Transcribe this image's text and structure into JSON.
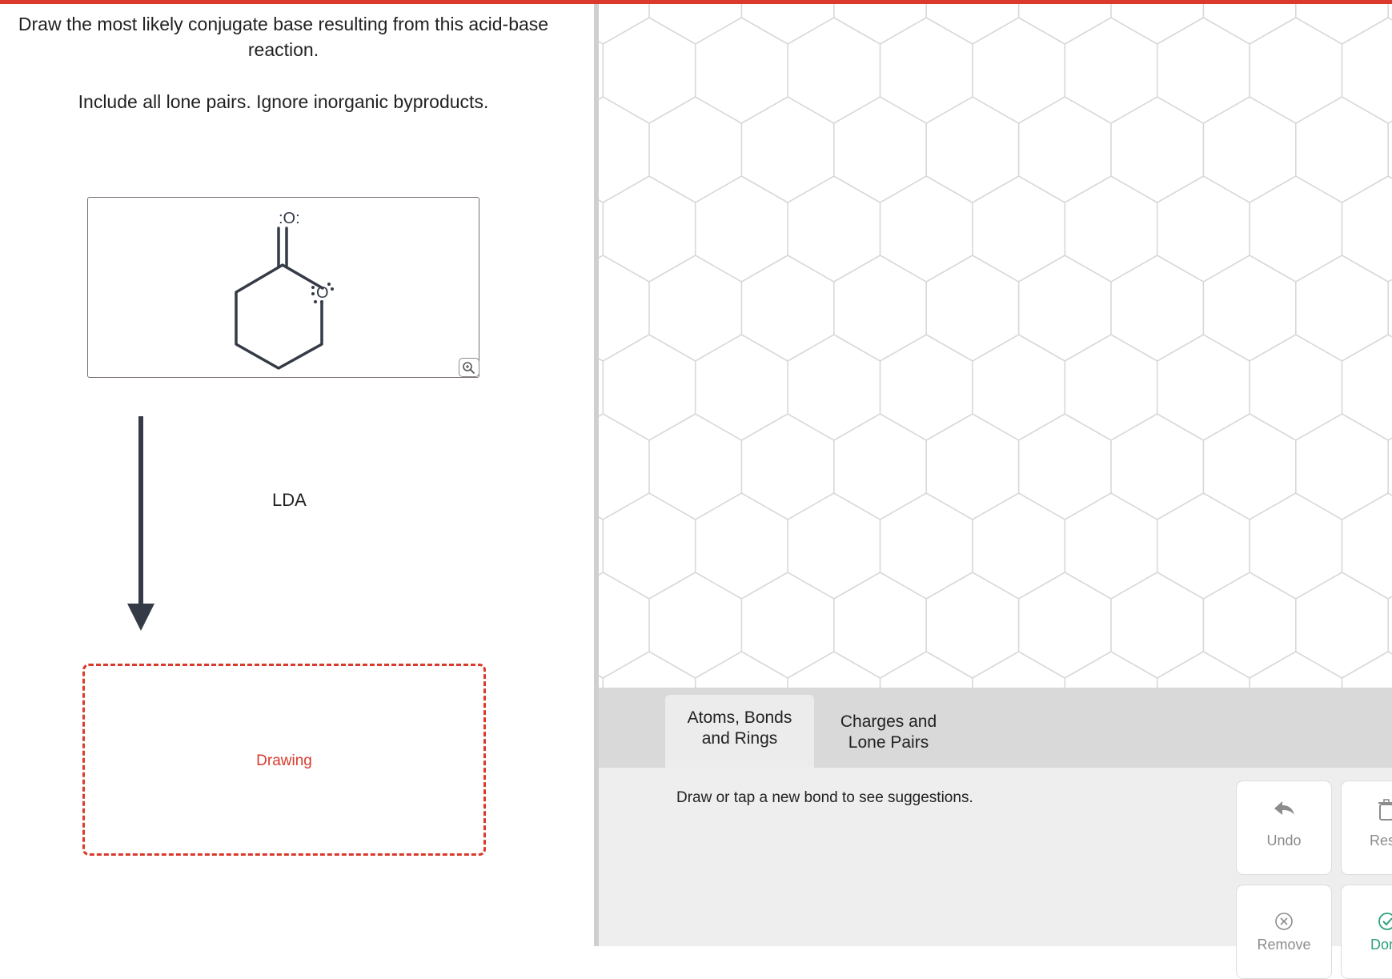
{
  "question": {
    "line1": "Draw the most likely conjugate base resulting from this acid-base reaction.",
    "line2": "Include all lone pairs. Ignore inorganic byproducts."
  },
  "reactant": {
    "carbonyl_oxygen": ":O:",
    "ring_oxygen": "O"
  },
  "reagent": "LDA",
  "answer_box": {
    "label": "Drawing"
  },
  "editor": {
    "tabs": [
      {
        "label": "Atoms, Bonds and Rings",
        "line1": "Atoms, Bonds",
        "line2": "and Rings",
        "active": true
      },
      {
        "label": "Charges and Lone Pairs",
        "line1": "Charges and",
        "line2": "Lone Pairs",
        "active": false
      }
    ],
    "hint": "Draw or tap a new bond to see suggestions.",
    "buttons": {
      "undo": "Undo",
      "reset": "Reset",
      "remove": "Remove",
      "done": "Done"
    }
  },
  "colors": {
    "accent": "#d93a2b",
    "structure": "#343a46",
    "grid": "#d8d8d8"
  }
}
